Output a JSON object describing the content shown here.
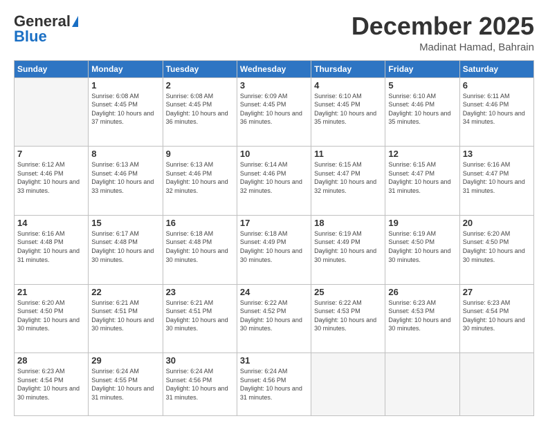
{
  "header": {
    "logo_general": "General",
    "logo_blue": "Blue",
    "month_title": "December 2025",
    "location": "Madinat Hamad, Bahrain"
  },
  "days_of_week": [
    "Sunday",
    "Monday",
    "Tuesday",
    "Wednesday",
    "Thursday",
    "Friday",
    "Saturday"
  ],
  "weeks": [
    [
      {
        "day": "",
        "sunrise": "",
        "sunset": "",
        "daylight": ""
      },
      {
        "day": "1",
        "sunrise": "6:08 AM",
        "sunset": "4:45 PM",
        "daylight": "10 hours and 37 minutes."
      },
      {
        "day": "2",
        "sunrise": "6:08 AM",
        "sunset": "4:45 PM",
        "daylight": "10 hours and 36 minutes."
      },
      {
        "day": "3",
        "sunrise": "6:09 AM",
        "sunset": "4:45 PM",
        "daylight": "10 hours and 36 minutes."
      },
      {
        "day": "4",
        "sunrise": "6:10 AM",
        "sunset": "4:45 PM",
        "daylight": "10 hours and 35 minutes."
      },
      {
        "day": "5",
        "sunrise": "6:10 AM",
        "sunset": "4:46 PM",
        "daylight": "10 hours and 35 minutes."
      },
      {
        "day": "6",
        "sunrise": "6:11 AM",
        "sunset": "4:46 PM",
        "daylight": "10 hours and 34 minutes."
      }
    ],
    [
      {
        "day": "7",
        "sunrise": "6:12 AM",
        "sunset": "4:46 PM",
        "daylight": "10 hours and 33 minutes."
      },
      {
        "day": "8",
        "sunrise": "6:13 AM",
        "sunset": "4:46 PM",
        "daylight": "10 hours and 33 minutes."
      },
      {
        "day": "9",
        "sunrise": "6:13 AM",
        "sunset": "4:46 PM",
        "daylight": "10 hours and 32 minutes."
      },
      {
        "day": "10",
        "sunrise": "6:14 AM",
        "sunset": "4:46 PM",
        "daylight": "10 hours and 32 minutes."
      },
      {
        "day": "11",
        "sunrise": "6:15 AM",
        "sunset": "4:47 PM",
        "daylight": "10 hours and 32 minutes."
      },
      {
        "day": "12",
        "sunrise": "6:15 AM",
        "sunset": "4:47 PM",
        "daylight": "10 hours and 31 minutes."
      },
      {
        "day": "13",
        "sunrise": "6:16 AM",
        "sunset": "4:47 PM",
        "daylight": "10 hours and 31 minutes."
      }
    ],
    [
      {
        "day": "14",
        "sunrise": "6:16 AM",
        "sunset": "4:48 PM",
        "daylight": "10 hours and 31 minutes."
      },
      {
        "day": "15",
        "sunrise": "6:17 AM",
        "sunset": "4:48 PM",
        "daylight": "10 hours and 30 minutes."
      },
      {
        "day": "16",
        "sunrise": "6:18 AM",
        "sunset": "4:48 PM",
        "daylight": "10 hours and 30 minutes."
      },
      {
        "day": "17",
        "sunrise": "6:18 AM",
        "sunset": "4:49 PM",
        "daylight": "10 hours and 30 minutes."
      },
      {
        "day": "18",
        "sunrise": "6:19 AM",
        "sunset": "4:49 PM",
        "daylight": "10 hours and 30 minutes."
      },
      {
        "day": "19",
        "sunrise": "6:19 AM",
        "sunset": "4:50 PM",
        "daylight": "10 hours and 30 minutes."
      },
      {
        "day": "20",
        "sunrise": "6:20 AM",
        "sunset": "4:50 PM",
        "daylight": "10 hours and 30 minutes."
      }
    ],
    [
      {
        "day": "21",
        "sunrise": "6:20 AM",
        "sunset": "4:50 PM",
        "daylight": "10 hours and 30 minutes."
      },
      {
        "day": "22",
        "sunrise": "6:21 AM",
        "sunset": "4:51 PM",
        "daylight": "10 hours and 30 minutes."
      },
      {
        "day": "23",
        "sunrise": "6:21 AM",
        "sunset": "4:51 PM",
        "daylight": "10 hours and 30 minutes."
      },
      {
        "day": "24",
        "sunrise": "6:22 AM",
        "sunset": "4:52 PM",
        "daylight": "10 hours and 30 minutes."
      },
      {
        "day": "25",
        "sunrise": "6:22 AM",
        "sunset": "4:53 PM",
        "daylight": "10 hours and 30 minutes."
      },
      {
        "day": "26",
        "sunrise": "6:23 AM",
        "sunset": "4:53 PM",
        "daylight": "10 hours and 30 minutes."
      },
      {
        "day": "27",
        "sunrise": "6:23 AM",
        "sunset": "4:54 PM",
        "daylight": "10 hours and 30 minutes."
      }
    ],
    [
      {
        "day": "28",
        "sunrise": "6:23 AM",
        "sunset": "4:54 PM",
        "daylight": "10 hours and 30 minutes."
      },
      {
        "day": "29",
        "sunrise": "6:24 AM",
        "sunset": "4:55 PM",
        "daylight": "10 hours and 31 minutes."
      },
      {
        "day": "30",
        "sunrise": "6:24 AM",
        "sunset": "4:56 PM",
        "daylight": "10 hours and 31 minutes."
      },
      {
        "day": "31",
        "sunrise": "6:24 AM",
        "sunset": "4:56 PM",
        "daylight": "10 hours and 31 minutes."
      },
      {
        "day": "",
        "sunrise": "",
        "sunset": "",
        "daylight": ""
      },
      {
        "day": "",
        "sunrise": "",
        "sunset": "",
        "daylight": ""
      },
      {
        "day": "",
        "sunrise": "",
        "sunset": "",
        "daylight": ""
      }
    ]
  ],
  "labels": {
    "sunrise_prefix": "Sunrise: ",
    "sunset_prefix": "Sunset: ",
    "daylight_prefix": "Daylight: "
  }
}
